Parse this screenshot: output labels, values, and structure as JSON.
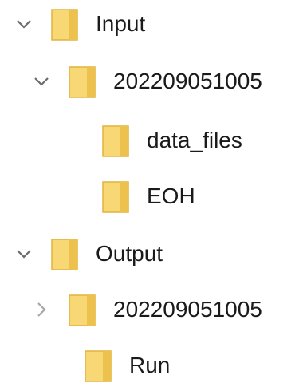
{
  "tree": {
    "items": [
      {
        "label": "Input",
        "state": "expanded"
      },
      {
        "label": "202209051005",
        "state": "expanded"
      },
      {
        "label": "data_files",
        "state": "leaf"
      },
      {
        "label": "EOH",
        "state": "leaf"
      },
      {
        "label": "Output",
        "state": "expanded"
      },
      {
        "label": "202209051005",
        "state": "collapsed"
      },
      {
        "label": "Run",
        "state": "leaf"
      }
    ]
  },
  "icons": {
    "folder": "folder-icon",
    "expanded": "chevron-down-icon",
    "collapsed": "chevron-right-icon"
  },
  "colors": {
    "folder_fill": "#F8D775",
    "folder_edge": "#E2B33C",
    "chevron": "#6b6b6b",
    "chevron_collapsed": "#a8a8a8",
    "text": "#1a1a1a"
  }
}
